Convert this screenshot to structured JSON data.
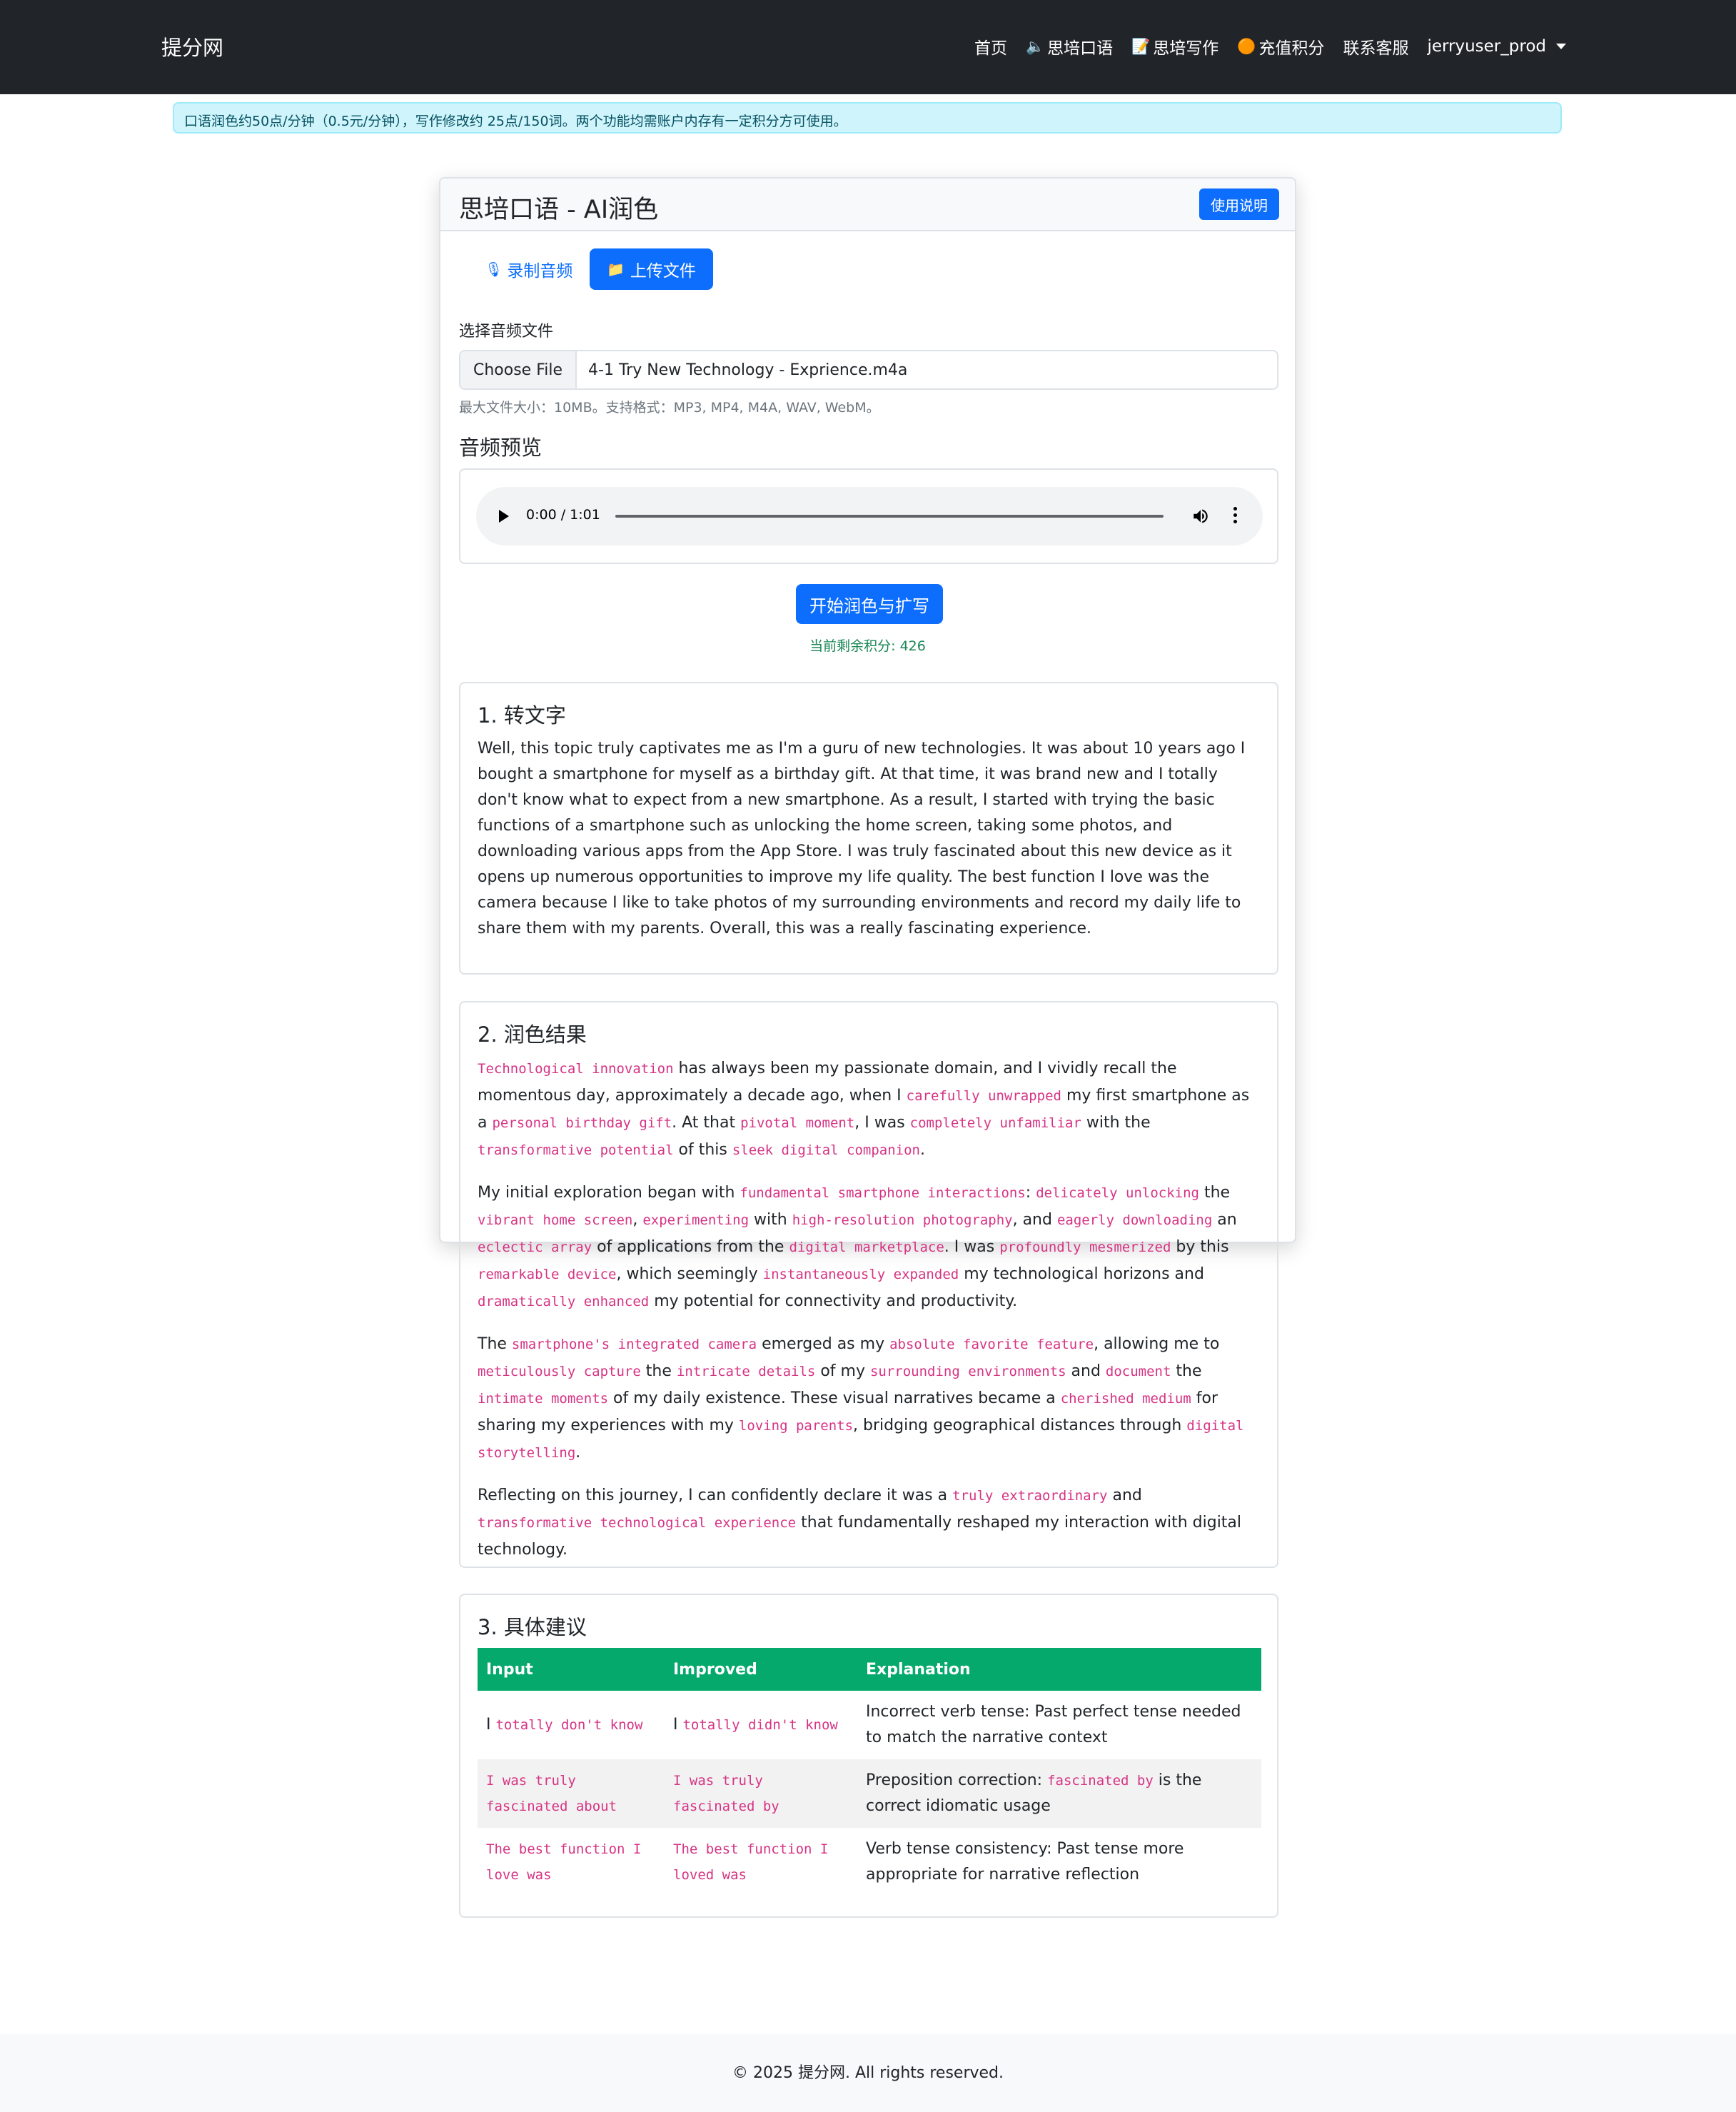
{
  "nav": {
    "brand": "提分网",
    "home": "首页",
    "speaking": "思培口语",
    "writing": "思培写作",
    "recharge": "充值积分",
    "support": "联系客服",
    "user": "jerryuser_prod",
    "speaking_icon": "🔈",
    "writing_icon": "📝",
    "recharge_icon": "🟠"
  },
  "alert": "口语润色约50点/分钟（0.5元/分钟），写作修改约 25点/150词。两个功能均需账户内存有一定积分方可使用。",
  "card": {
    "title": "思培口语 - AI润色",
    "help_button": "使用说明",
    "tab_record": "录制音频",
    "tab_upload": "上传文件",
    "tab_record_icon": "🎙",
    "tab_upload_icon": "📁",
    "file_label": "选择音频文件",
    "choose_file": "Choose File",
    "file_name": "4-1 Try New Technology - Exprience.m4a",
    "file_help": "最大文件大小：10MB。支持格式：MP3, MP4, M4A, WAV, WebM。",
    "preview_title": "音频预览",
    "audio_time": "0:00 / 1:01",
    "start_button": "开始润色与扩写",
    "balance": "当前剩余积分: 426"
  },
  "transcript": {
    "title": "1. 转文字",
    "text": "Well, this topic truly captivates me as I'm a guru of new technologies. It was about 10 years ago I bought a smartphone for myself as a birthday gift. At that time, it was brand new and I totally don't know what to expect from a new smartphone. As a result, I started with trying the basic functions of a smartphone such as unlocking the home screen, taking some photos, and downloading various apps from the App Store. I was truly fascinated about this new device as it opens up numerous opportunities to improve my life quality. The best function I love was the camera because I like to take photos of my surrounding environments and record my daily life to share them with my parents. Overall, this was a really fascinating experience."
  },
  "polished": {
    "title": "2. 润色结果",
    "paragraphs": [
      [
        {
          "t": "Technological innovation",
          "c": 1
        },
        {
          "t": " has always been my passionate domain, and I vividly recall the momentous day, approximately a decade ago, when I "
        },
        {
          "t": "carefully unwrapped",
          "c": 1
        },
        {
          "t": " my first smartphone as a "
        },
        {
          "t": "personal birthday gift",
          "c": 1
        },
        {
          "t": ". At that "
        },
        {
          "t": "pivotal moment",
          "c": 1
        },
        {
          "t": ", I was "
        },
        {
          "t": "completely unfamiliar",
          "c": 1
        },
        {
          "t": " with the "
        },
        {
          "t": "transformative potential",
          "c": 1
        },
        {
          "t": " of this "
        },
        {
          "t": "sleek digital companion",
          "c": 1
        },
        {
          "t": "."
        }
      ],
      [
        {
          "t": "My initial exploration began with "
        },
        {
          "t": "fundamental smartphone interactions",
          "c": 1
        },
        {
          "t": ": "
        },
        {
          "t": "delicately unlocking",
          "c": 1
        },
        {
          "t": " the "
        },
        {
          "t": "vibrant home screen",
          "c": 1
        },
        {
          "t": ", "
        },
        {
          "t": "experimenting",
          "c": 1
        },
        {
          "t": " with "
        },
        {
          "t": "high-resolution photography",
          "c": 1
        },
        {
          "t": ", and "
        },
        {
          "t": "eagerly downloading",
          "c": 1
        },
        {
          "t": " an "
        },
        {
          "t": "eclectic array",
          "c": 1
        },
        {
          "t": " of applications from the "
        },
        {
          "t": "digital marketplace",
          "c": 1
        },
        {
          "t": ". I was "
        },
        {
          "t": "profoundly mesmerized",
          "c": 1
        },
        {
          "t": " by this "
        },
        {
          "t": "remarkable device",
          "c": 1
        },
        {
          "t": ", which seemingly "
        },
        {
          "t": "instantaneously expanded",
          "c": 1
        },
        {
          "t": " my technological horizons and "
        },
        {
          "t": "dramatically enhanced",
          "c": 1
        },
        {
          "t": " my potential for connectivity and productivity."
        }
      ],
      [
        {
          "t": "The "
        },
        {
          "t": "smartphone's integrated camera",
          "c": 1
        },
        {
          "t": " emerged as my "
        },
        {
          "t": "absolute favorite feature",
          "c": 1
        },
        {
          "t": ", allowing me to "
        },
        {
          "t": "meticulously capture",
          "c": 1
        },
        {
          "t": " the "
        },
        {
          "t": "intricate details",
          "c": 1
        },
        {
          "t": " of my "
        },
        {
          "t": "surrounding environments",
          "c": 1
        },
        {
          "t": " and "
        },
        {
          "t": "document",
          "c": 1
        },
        {
          "t": " the "
        },
        {
          "t": "intimate moments",
          "c": 1
        },
        {
          "t": " of my daily existence. These visual narratives became a "
        },
        {
          "t": "cherished medium",
          "c": 1
        },
        {
          "t": " for sharing my experiences with my "
        },
        {
          "t": "loving parents",
          "c": 1
        },
        {
          "t": ", bridging geographical distances through "
        },
        {
          "t": "digital storytelling",
          "c": 1
        },
        {
          "t": "."
        }
      ],
      [
        {
          "t": "Reflecting on this journey, I can confidently declare it was a "
        },
        {
          "t": "truly extraordinary",
          "c": 1
        },
        {
          "t": " and "
        },
        {
          "t": "transformative technological experience",
          "c": 1
        },
        {
          "t": " that fundamentally reshaped my interaction with digital technology."
        }
      ]
    ]
  },
  "suggestions": {
    "title": "3. 具体建议",
    "headers": [
      "Input",
      "Improved",
      "Explanation"
    ],
    "rows": [
      {
        "input": [
          {
            "t": "I "
          },
          {
            "t": "totally don't know",
            "c": 1
          }
        ],
        "improved": [
          {
            "t": "I "
          },
          {
            "t": "totally didn't know",
            "c": 1
          }
        ],
        "explanation": [
          {
            "t": "Incorrect verb tense: Past perfect tense needed to match the narrative context"
          }
        ]
      },
      {
        "input": [
          {
            "t": "I was truly fascinated about",
            "c": 1
          }
        ],
        "improved": [
          {
            "t": "I was truly fascinated by",
            "c": 1
          }
        ],
        "explanation": [
          {
            "t": "Preposition correction: "
          },
          {
            "t": "fascinated by",
            "c": 1
          },
          {
            "t": " is the correct idiomatic usage"
          }
        ]
      },
      {
        "input": [
          {
            "t": "The best function I love was",
            "c": 1
          }
        ],
        "improved": [
          {
            "t": "The best function I loved was",
            "c": 1
          }
        ],
        "explanation": [
          {
            "t": "Verb tense consistency: Past tense more appropriate for narrative reflection"
          }
        ]
      }
    ]
  },
  "footer": "© 2025 提分网. All rights reserved.",
  "colors": {
    "navbar": "#212529",
    "primary": "#0d6efd",
    "alert_bg": "#cff4fc",
    "table_header": "#04a96b",
    "code": "#d63384",
    "success": "#198754"
  }
}
